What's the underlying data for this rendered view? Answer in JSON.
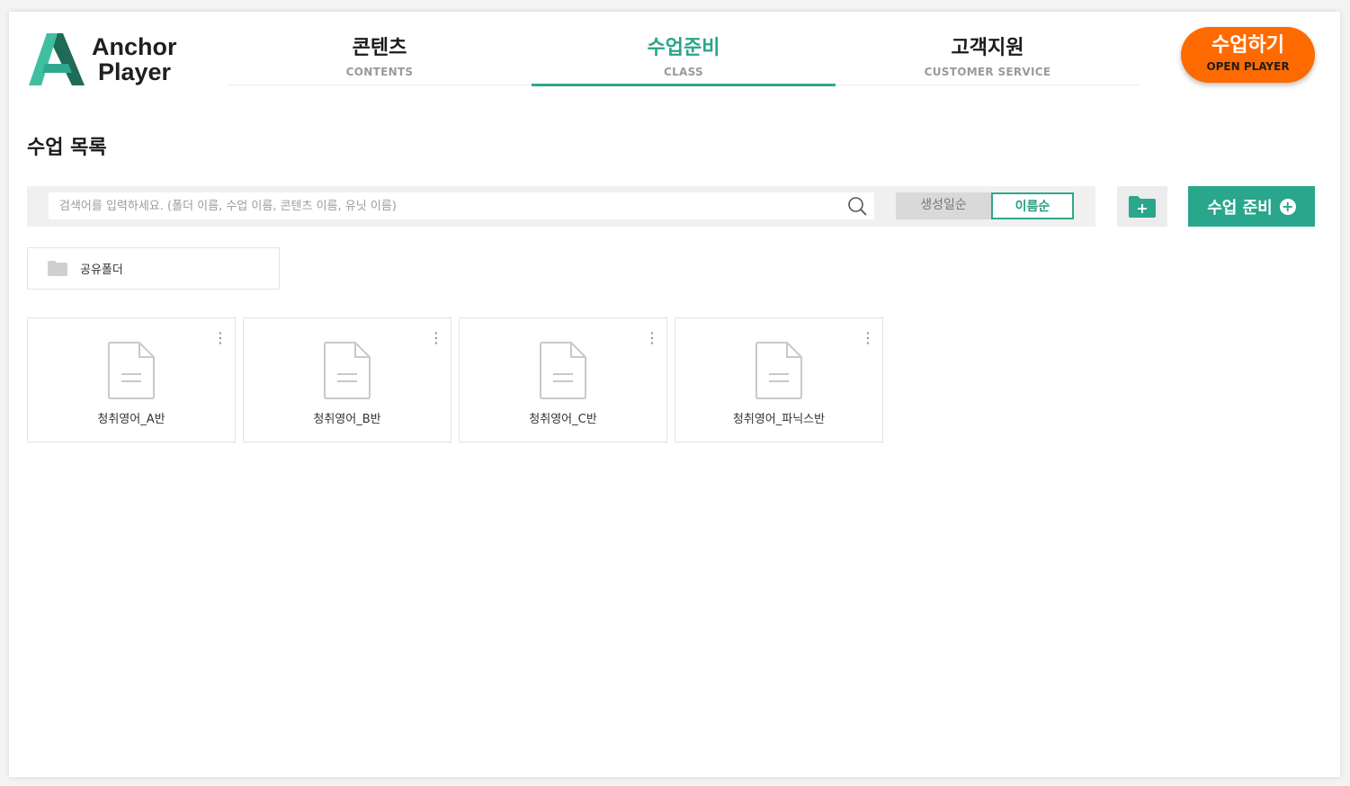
{
  "brand": {
    "line1": "Anchor",
    "line2": "Player",
    "colors": {
      "dark": "#1f6b57",
      "mid": "#2fa88e",
      "light": "#3fc2a3"
    }
  },
  "nav": {
    "tabs": [
      {
        "ko": "콘텐츠",
        "en": "CONTENTS",
        "active": false
      },
      {
        "ko": "수업준비",
        "en": "CLASS",
        "active": true
      },
      {
        "ko": "고객지원",
        "en": "CUSTOMER SERVICE",
        "active": false
      }
    ],
    "active_color": "#29a58a"
  },
  "open_player": {
    "ko": "수업하기",
    "en": "OPEN PLAYER",
    "color": "#ff6a00"
  },
  "page": {
    "title": "수업 목록"
  },
  "search": {
    "placeholder": "검색어를 입력하세요. (폴더 이름, 수업 이름, 콘텐츠 이름, 유닛 이름)",
    "value": "",
    "icon": "search-icon"
  },
  "sort": {
    "created_label": "생성일순",
    "name_label": "이름순",
    "selected": "이름순"
  },
  "actions": {
    "new_folder_icon": "folder-plus-icon",
    "prepare_label": "수업 준비",
    "accent": "#29a68b"
  },
  "folders": [
    {
      "label": "공유폴더",
      "icon": "folder-icon"
    }
  ],
  "classes": [
    {
      "name": "청취영어_A반",
      "icon": "document-icon"
    },
    {
      "name": "청취영어_B반",
      "icon": "document-icon"
    },
    {
      "name": "청취영어_C반",
      "icon": "document-icon"
    },
    {
      "name": "청취영어_파닉스반",
      "icon": "document-icon"
    }
  ]
}
